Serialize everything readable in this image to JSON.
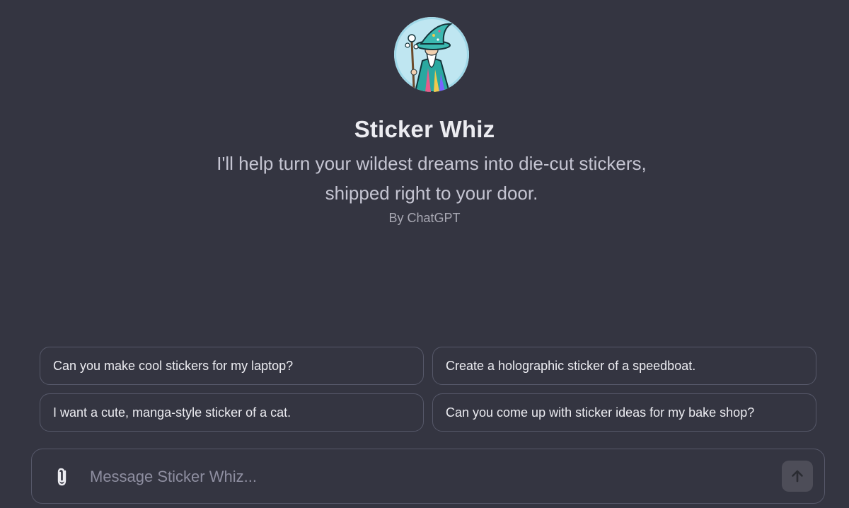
{
  "gpt": {
    "name": "Sticker Whiz",
    "description": "I'll help turn your wildest dreams into die-cut stickers, shipped right to your door.",
    "author": "By ChatGPT",
    "avatar_icon": "wizard-sticker-icon"
  },
  "suggestions": [
    "Can you make cool stickers for my laptop?",
    "Create a holographic sticker of a speedboat.",
    "I want a cute, manga-style sticker of a cat.",
    "Can you come up with sticker ideas for my bake shop?"
  ],
  "composer": {
    "placeholder": "Message Sticker Whiz...",
    "value": "",
    "attach_icon": "paperclip-icon",
    "send_icon": "arrow-up-icon"
  },
  "colors": {
    "background": "#343541",
    "border": "#565869",
    "text": "#ececf1",
    "muted_text": "#c5c5d2",
    "send_button": "#4d4d58"
  }
}
